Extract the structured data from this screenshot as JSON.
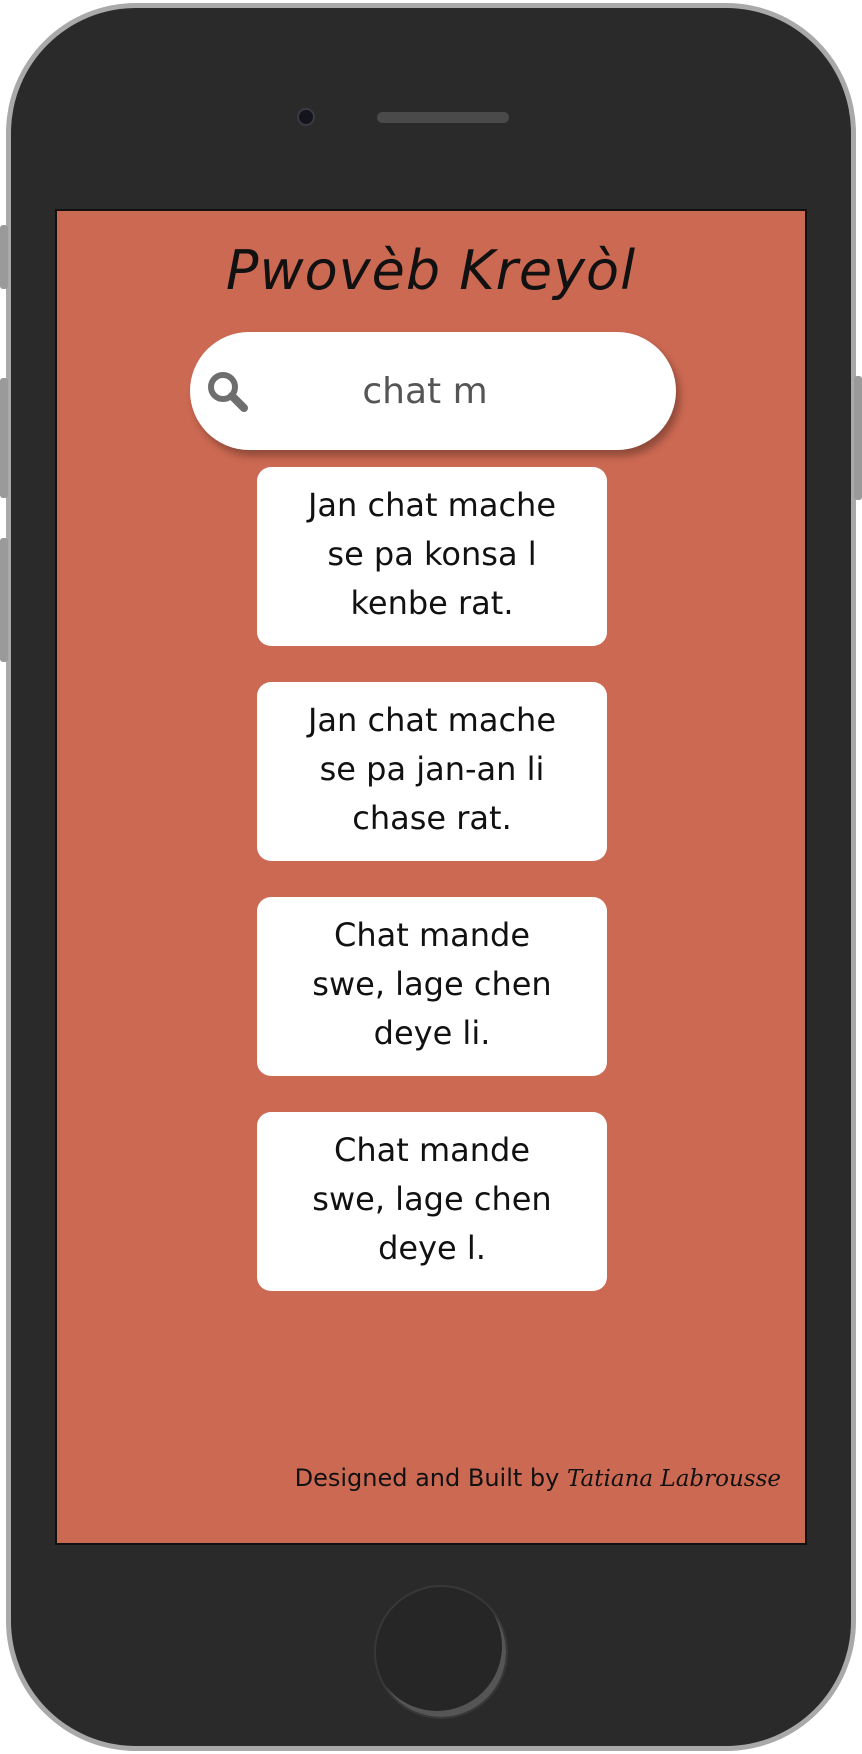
{
  "app": {
    "title": "Pwovèb Kreyòl"
  },
  "search": {
    "value": "chat m",
    "icon": "search-icon"
  },
  "results": [
    {
      "text": "Jan chat mache se pa konsa l kenbe rat."
    },
    {
      "text": "Jan chat mache se pa jan-an li chase rat."
    },
    {
      "text": "Chat mande swe, lage chen deye li."
    },
    {
      "text": "Chat mande swe, lage chen deye l."
    }
  ],
  "footer": {
    "prefix": "Designed and Built by",
    "author": "Tatiana Labrousse"
  },
  "colors": {
    "background": "#cc6952",
    "card": "#ffffff",
    "phone_body": "#2a2a2a"
  }
}
